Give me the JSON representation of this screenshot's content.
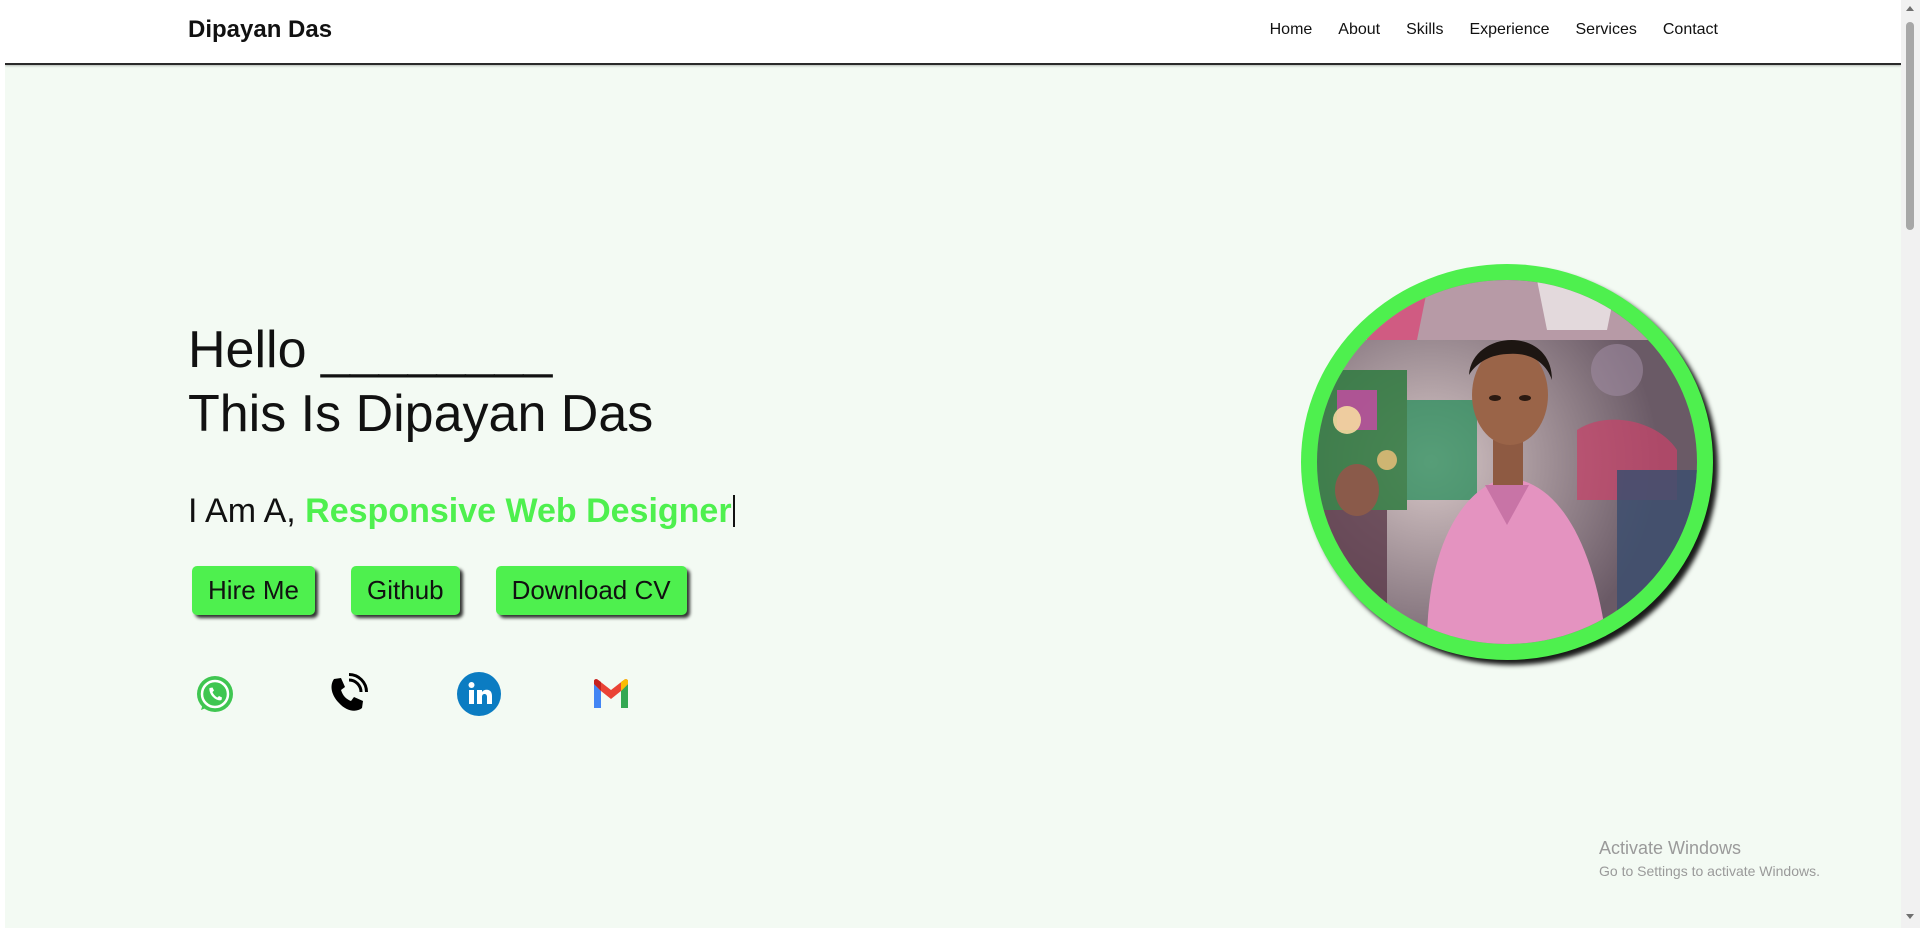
{
  "nav": {
    "brand": "Dipayan Das",
    "links": [
      "Home",
      "About",
      "Skills",
      "Experience",
      "Services",
      "Contact"
    ]
  },
  "hero": {
    "hello": "Hello ________",
    "name_line": "This Is Dipayan Das",
    "role_prefix": "I Am A, ",
    "role_accent": "Responsive Web Designer",
    "buttons": {
      "hire": "Hire Me",
      "github": "Github",
      "cv": "Download CV"
    },
    "socials": [
      "whatsapp-icon",
      "phone-icon",
      "linkedin-icon",
      "gmail-icon"
    ]
  },
  "watermark": {
    "title": "Activate Windows",
    "subtitle": "Go to Settings to activate Windows."
  },
  "colors": {
    "accent": "#4ef04e",
    "background": "#f3faf3"
  }
}
